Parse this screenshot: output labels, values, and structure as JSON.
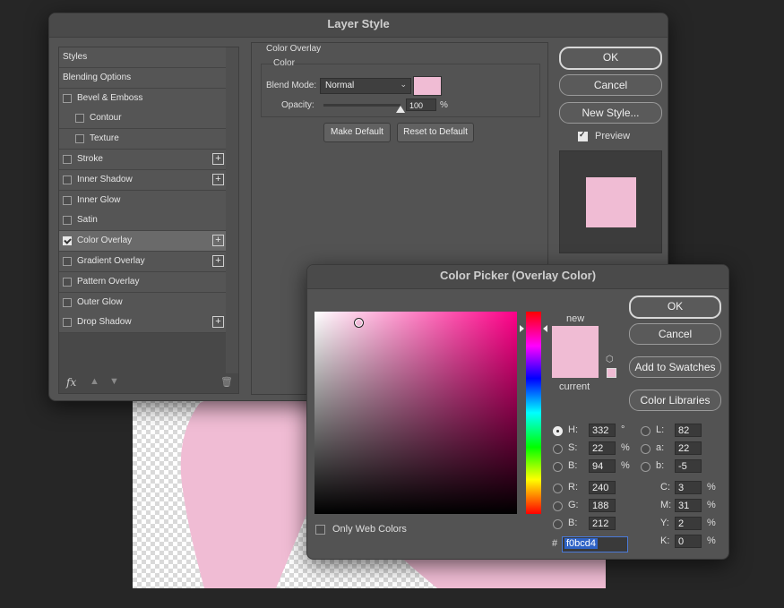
{
  "layer_style": {
    "title": "Layer Style",
    "styles_list": [
      {
        "label": "Styles",
        "checkbox": false,
        "indent": 0,
        "plus": false,
        "checked": false,
        "selected": false
      },
      {
        "label": "Blending Options",
        "checkbox": false,
        "indent": 0,
        "plus": false,
        "checked": false,
        "selected": false
      },
      {
        "label": "Bevel & Emboss",
        "checkbox": true,
        "indent": 0,
        "plus": false,
        "checked": false,
        "selected": false
      },
      {
        "label": "Contour",
        "checkbox": true,
        "indent": 1,
        "plus": false,
        "checked": false,
        "selected": false
      },
      {
        "label": "Texture",
        "checkbox": true,
        "indent": 1,
        "plus": false,
        "checked": false,
        "selected": false
      },
      {
        "label": "Stroke",
        "checkbox": true,
        "indent": 0,
        "plus": true,
        "checked": false,
        "selected": false
      },
      {
        "label": "Inner Shadow",
        "checkbox": true,
        "indent": 0,
        "plus": true,
        "checked": false,
        "selected": false
      },
      {
        "label": "Inner Glow",
        "checkbox": true,
        "indent": 0,
        "plus": false,
        "checked": false,
        "selected": false
      },
      {
        "label": "Satin",
        "checkbox": true,
        "indent": 0,
        "plus": false,
        "checked": false,
        "selected": false
      },
      {
        "label": "Color Overlay",
        "checkbox": true,
        "indent": 0,
        "plus": true,
        "checked": true,
        "selected": true
      },
      {
        "label": "Gradient Overlay",
        "checkbox": true,
        "indent": 0,
        "plus": true,
        "checked": false,
        "selected": false
      },
      {
        "label": "Pattern Overlay",
        "checkbox": true,
        "indent": 0,
        "plus": false,
        "checked": false,
        "selected": false
      },
      {
        "label": "Outer Glow",
        "checkbox": true,
        "indent": 0,
        "plus": false,
        "checked": false,
        "selected": false
      },
      {
        "label": "Drop Shadow",
        "checkbox": true,
        "indent": 0,
        "plus": true,
        "checked": false,
        "selected": false
      }
    ],
    "footer_icons": [
      "fx-icon",
      "arrow-up-icon",
      "arrow-down-icon",
      "trash-icon"
    ],
    "section_title": "Color Overlay",
    "group_title": "Color",
    "blend_mode_label": "Blend Mode:",
    "blend_mode_value": "Normal",
    "opacity_label": "Opacity:",
    "opacity_value": "100",
    "opacity_unit": "%",
    "opacity_level": 1.0,
    "make_default": "Make Default",
    "reset_default": "Reset to Default",
    "ok": "OK",
    "cancel": "Cancel",
    "new_style": "New Style...",
    "preview_label": "Preview",
    "overlay_color": "#f0bcd4"
  },
  "color_picker": {
    "title": "Color Picker (Overlay Color)",
    "ok": "OK",
    "cancel": "Cancel",
    "add_to_swatches": "Add to Swatches",
    "color_libraries": "Color Libraries",
    "new_label": "new",
    "current_label": "current",
    "only_web_colors": "Only Web Colors",
    "hue_color": "#ff0088",
    "hsb": [
      {
        "label": "H:",
        "value": "332",
        "unit": "°",
        "selected": true
      },
      {
        "label": "S:",
        "value": "22",
        "unit": "%",
        "selected": false
      },
      {
        "label": "B:",
        "value": "94",
        "unit": "%",
        "selected": false
      }
    ],
    "rgb": [
      {
        "label": "R:",
        "value": "240"
      },
      {
        "label": "G:",
        "value": "188"
      },
      {
        "label": "B:",
        "value": "212"
      }
    ],
    "lab": [
      {
        "label": "L:",
        "value": "82"
      },
      {
        "label": "a:",
        "value": "22"
      },
      {
        "label": "b:",
        "value": "-5"
      }
    ],
    "cmyk": [
      {
        "label": "C:",
        "value": "3",
        "unit": "%"
      },
      {
        "label": "M:",
        "value": "31",
        "unit": "%"
      },
      {
        "label": "Y:",
        "value": "2",
        "unit": "%"
      },
      {
        "label": "K:",
        "value": "0",
        "unit": "%"
      }
    ],
    "hex_prefix": "#",
    "hex_value": "f0bcd4"
  }
}
